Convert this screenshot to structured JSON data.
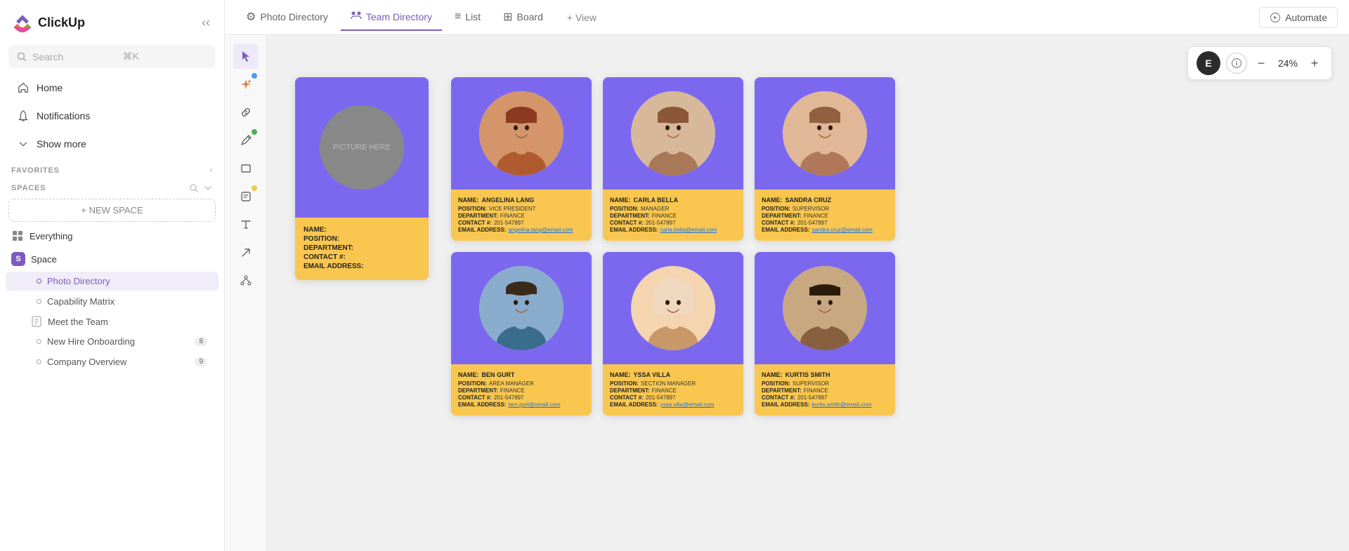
{
  "app": {
    "name": "ClickUp"
  },
  "sidebar": {
    "search": {
      "placeholder": "Search",
      "shortcut": "⌘K"
    },
    "nav": [
      {
        "id": "home",
        "label": "Home",
        "icon": "home"
      },
      {
        "id": "notifications",
        "label": "Notifications",
        "icon": "bell"
      },
      {
        "id": "show-more",
        "label": "Show more",
        "icon": "chevron-down"
      }
    ],
    "favorites_label": "FAVORITES",
    "spaces_label": "SPACES",
    "new_space_label": "+ NEW SPACE",
    "spaces": [
      {
        "id": "everything",
        "label": "Everything",
        "type": "all"
      },
      {
        "id": "space",
        "label": "Space",
        "type": "space",
        "badge": "S",
        "children": [
          {
            "id": "photo-directory",
            "label": "Photo Directory",
            "active": true
          },
          {
            "id": "capability-matrix",
            "label": "Capability Matrix"
          },
          {
            "id": "meet-the-team",
            "label": "Meet the Team",
            "type": "doc"
          },
          {
            "id": "new-hire-onboarding",
            "label": "New Hire Onboarding",
            "badge": "8"
          },
          {
            "id": "company-overview",
            "label": "Company Overview",
            "badge": "9"
          }
        ]
      }
    ]
  },
  "tabs": [
    {
      "id": "photo-directory",
      "label": "Photo Directory",
      "icon": "⚙",
      "active": false
    },
    {
      "id": "team-directory",
      "label": "Team Directory",
      "icon": "🔗",
      "active": true
    },
    {
      "id": "list",
      "label": "List",
      "icon": "≡"
    },
    {
      "id": "board",
      "label": "Board",
      "icon": "▦"
    },
    {
      "id": "view",
      "label": "+ View",
      "icon": ""
    }
  ],
  "toolbar": {
    "automate_label": "Automate"
  },
  "tools": [
    {
      "id": "cursor",
      "icon": "▷",
      "active": true,
      "dot": null
    },
    {
      "id": "sparkle",
      "icon": "✦",
      "active": false,
      "dot": "blue"
    },
    {
      "id": "link",
      "icon": "🔗",
      "active": false,
      "dot": null
    },
    {
      "id": "pencil",
      "icon": "✏",
      "active": false,
      "dot": "green"
    },
    {
      "id": "rectangle",
      "icon": "▭",
      "active": false,
      "dot": null
    },
    {
      "id": "note",
      "icon": "🗒",
      "active": false,
      "dot": "yellow"
    },
    {
      "id": "text",
      "icon": "T",
      "active": false,
      "dot": null
    },
    {
      "id": "arrow",
      "icon": "↗",
      "active": false,
      "dot": null
    },
    {
      "id": "network",
      "icon": "⬡",
      "active": false,
      "dot": null
    }
  ],
  "zoom": {
    "value": "24%",
    "user_initial": "E"
  },
  "template_card": {
    "placeholder_text": "PICTURE HERE",
    "fields": [
      {
        "label": "NAME:",
        "value": ""
      },
      {
        "label": "POSITION:",
        "value": ""
      },
      {
        "label": "DEPARTMENT:",
        "value": ""
      },
      {
        "label": "CONTACT #:",
        "value": ""
      },
      {
        "label": "EMAIL ADDRESS:",
        "value": ""
      }
    ]
  },
  "people": [
    {
      "id": "angelina-lang",
      "name": "ANGELINA LANG",
      "position": "VICE PRESIDENT",
      "department": "FINANCE",
      "contact": "201-547897",
      "email": "angelina.lang@email.com",
      "face": "1"
    },
    {
      "id": "carla-bella",
      "name": "CARLA BELLA",
      "position": "MANAGER",
      "department": "FINANCE",
      "contact": "201-547897",
      "email": "carla.bella@email.com",
      "face": "2"
    },
    {
      "id": "sandra-cruz",
      "name": "SANDRA CRUZ",
      "position": "SUPERVISOR",
      "department": "FINANCE",
      "contact": "201-547897",
      "email": "sandra.cruz@email.com",
      "face": "3"
    },
    {
      "id": "ben-gurt",
      "name": "BEN GURT",
      "position": "AREA MANAGER",
      "department": "FINANCE",
      "contact": "201-547897",
      "email": "ben.gurt@email.com",
      "face": "4"
    },
    {
      "id": "yssa-villa",
      "name": "YSSA VILLA",
      "position": "SECTION MANAGER",
      "department": "FINANCE",
      "contact": "201-547897",
      "email": "yssa.villa@email.com",
      "face": "5"
    },
    {
      "id": "kurtis-smith",
      "name": "KURTIS SMITH",
      "position": "SUPERVISOR",
      "department": "FINANCE",
      "contact": "201-547897",
      "email": "kurtis.smith@email.com",
      "face": "6"
    }
  ]
}
